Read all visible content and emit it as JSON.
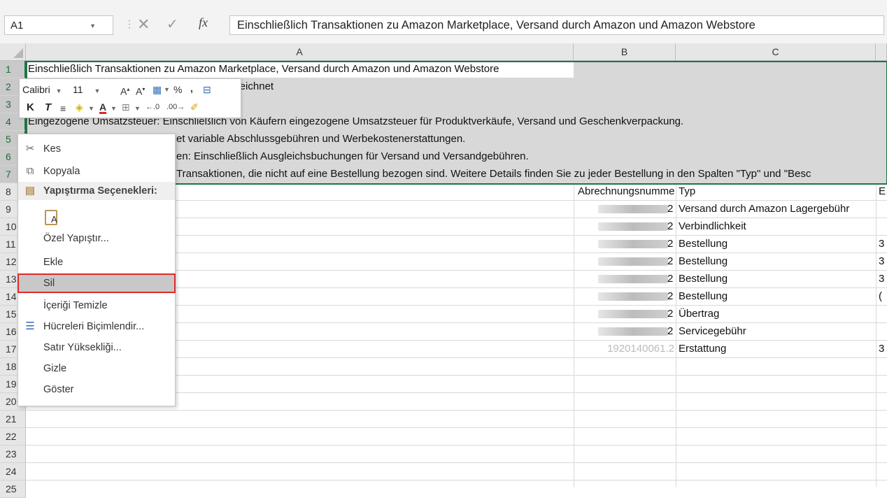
{
  "formula_bar": {
    "name_box": "A1",
    "formula": "Einschließlich Transaktionen zu Amazon Marketplace, Versand durch Amazon und Amazon Webstore",
    "fx": "fx",
    "separator": "⋮",
    "cancel_glyph": "✕",
    "enter_glyph": "✓"
  },
  "columns": [
    "A",
    "B",
    "C"
  ],
  "rows": [
    "1",
    "2",
    "3",
    "4",
    "5",
    "6",
    "7",
    "8",
    "9",
    "10",
    "11",
    "12",
    "13",
    "14",
    "15",
    "16",
    "17",
    "18",
    "19",
    "20",
    "21",
    "22",
    "23",
    "24",
    "25"
  ],
  "cells": {
    "r1": "Einschließlich Transaktionen zu Amazon Marketplace, Versand durch Amazon und Amazon Webstore",
    "r2": "gekennzeichnet",
    "r4": "Eingezogene Umsatzsteuer: Einschließlich von Käufern eingezogene Umsatzsteuer für Produktverkäufe, Versand und Geschenkverpackung.",
    "r5": "et variable Abschlussgebühren und Werbekostenerstattungen.",
    "r6": "en: Einschließlich Ausgleichsbuchungen für Versand und Versandgebühren.",
    "r7": "Transaktionen, die nicht auf eine Bestellung bezogen sind. Weitere Details finden Sie zu jeder Bestellung in den Spalten \"Typ\" und \"Besc",
    "b8": "Abrechnungsnummer",
    "c8": "Typ",
    "b_suffix": "2",
    "b17": "1920140061.2",
    "types": [
      "Versand durch Amazon Lagergebühr",
      "Verbindlichkeit",
      "Bestellung",
      "Bestellung",
      "Bestellung",
      "Bestellung",
      "Übertrag",
      "Servicegebühr",
      "Erstattung"
    ],
    "d_partial": [
      "",
      "",
      "3",
      "3",
      "3",
      "(",
      "",
      "",
      "3"
    ],
    "d8": "E"
  },
  "mini_toolbar": {
    "font": "Calibri",
    "size": "11",
    "bold": "K",
    "italic": "T",
    "percent": "%",
    "comma": ","
  },
  "context_menu": {
    "items": [
      {
        "label": "Kes",
        "icon": "scissors-icon"
      },
      {
        "label": "Kopyala",
        "icon": "copy-icon"
      },
      {
        "label": "Yapıştırma Seçenekleri:",
        "icon": "clipboard-icon"
      },
      {
        "label": "A",
        "icon": "paste-icon"
      },
      {
        "label": "Özel Yapıştır...",
        "icon": ""
      },
      {
        "label": "Ekle",
        "icon": ""
      },
      {
        "label": "Sil",
        "icon": ""
      },
      {
        "label": "İçeriği Temizle",
        "icon": ""
      },
      {
        "label": "Hücreleri Biçimlendir...",
        "icon": "format-cells-icon"
      },
      {
        "label": "Satır Yüksekliği...",
        "icon": ""
      },
      {
        "label": "Gizle",
        "icon": ""
      },
      {
        "label": "Göster",
        "icon": ""
      }
    ],
    "highlight_color": "#e0292b"
  }
}
